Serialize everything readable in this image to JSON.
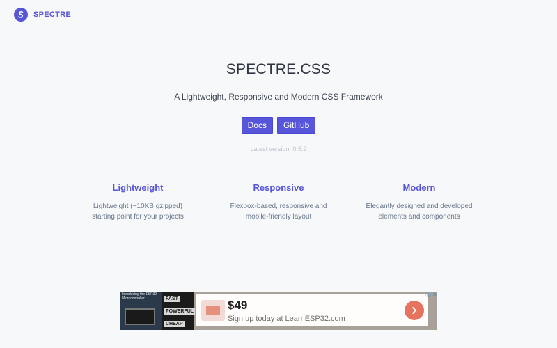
{
  "brand": {
    "name": "SPECTRE",
    "logo_icon": "spectre-logo-icon",
    "accent_color": "#5755d9"
  },
  "hero": {
    "title": "SPECTRE.CSS",
    "subtitle_prefix": "A ",
    "subtitle_word_1": "Lightweight",
    "subtitle_sep_1": ", ",
    "subtitle_word_2": "Responsive",
    "subtitle_sep_2": " and ",
    "subtitle_word_3": "Modern",
    "subtitle_suffix": " CSS Framework",
    "docs_label": "Docs",
    "github_label": "GitHub",
    "version_text": "Latest version: 0.5.9"
  },
  "features": [
    {
      "title": "Lightweight",
      "desc_line_1": "Lightweight (~10KB gzipped)",
      "desc_line_2": "starting point for your projects"
    },
    {
      "title": "Responsive",
      "desc_line_1": "Flexbox-based, responsive and",
      "desc_line_2": "mobile-friendly layout"
    },
    {
      "title": "Modern",
      "desc_line_1": "Elegantly designed and developed",
      "desc_line_2": "elements and components"
    }
  ],
  "ad": {
    "thumb_caption": "Introducing the ESP32 Microcontroller",
    "thumb_tag_1": "FAST",
    "thumb_tag_2": "POWERFUL",
    "thumb_tag_3": "CHEAP",
    "price": "$49",
    "tagline": "Sign up today at LearnESP32.com",
    "cta_icon": "chevron-right-icon",
    "info_icon": "ad-info-icon",
    "close_icon": "ad-close-icon",
    "info_glyph": "ⓘ",
    "close_glyph": "✕",
    "cta_color": "#e5735d"
  }
}
